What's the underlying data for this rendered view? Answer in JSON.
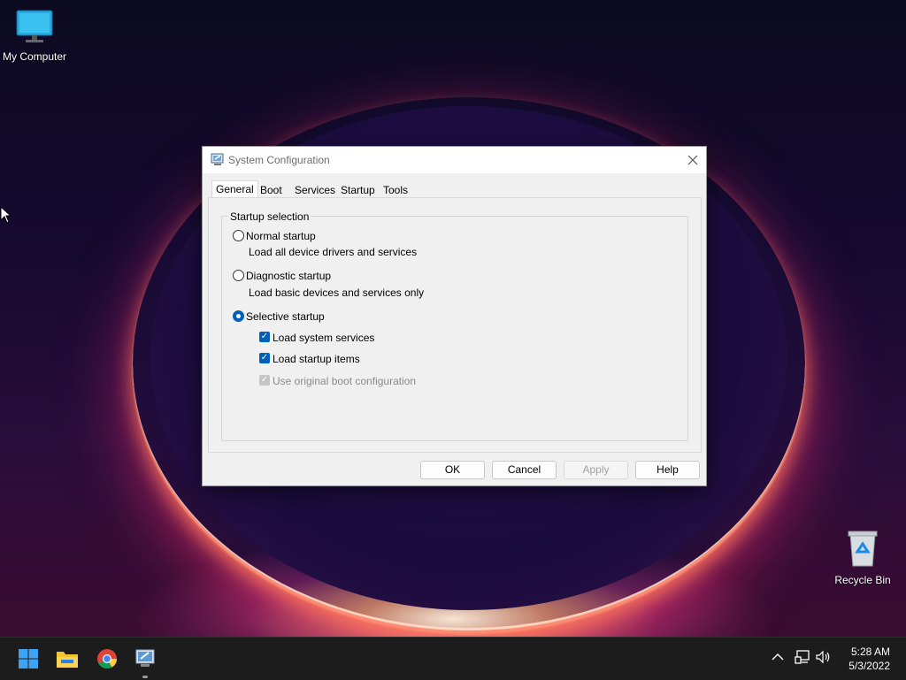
{
  "desktop": {
    "icons": [
      {
        "label": "My Computer",
        "icon": "monitor-icon"
      },
      {
        "label": "Recycle Bin",
        "icon": "recycle-bin-icon"
      }
    ]
  },
  "dialog": {
    "title": "System Configuration",
    "close_icon": "close-icon",
    "tabs": [
      "General",
      "Boot",
      "Services",
      "Startup",
      "Tools"
    ],
    "active_tab": "General",
    "group_title": "Startup selection",
    "options": [
      {
        "label": "Normal startup",
        "description": "Load all device drivers and services",
        "selected": false
      },
      {
        "label": "Diagnostic startup",
        "description": "Load basic devices and services only",
        "selected": false
      },
      {
        "label": "Selective startup",
        "selected": true
      }
    ],
    "checkboxes": [
      {
        "label": "Load system services",
        "checked": true,
        "enabled": true
      },
      {
        "label": "Load startup items",
        "checked": true,
        "enabled": true
      },
      {
        "label": "Use original boot configuration",
        "checked": true,
        "enabled": false
      }
    ],
    "buttons": {
      "ok": "OK",
      "cancel": "Cancel",
      "apply": "Apply",
      "help": "Help"
    }
  },
  "taskbar": {
    "apps": [
      "windows-start-icon",
      "file-explorer-icon",
      "chrome-icon",
      "system-configuration-icon"
    ],
    "tray_icons": [
      "chevron-up-icon",
      "network-icon",
      "volume-icon"
    ],
    "time": "5:28 AM",
    "date": "5/3/2022"
  },
  "colors": {
    "accent": "#005fb8",
    "taskbar": "#1c1c1c"
  }
}
